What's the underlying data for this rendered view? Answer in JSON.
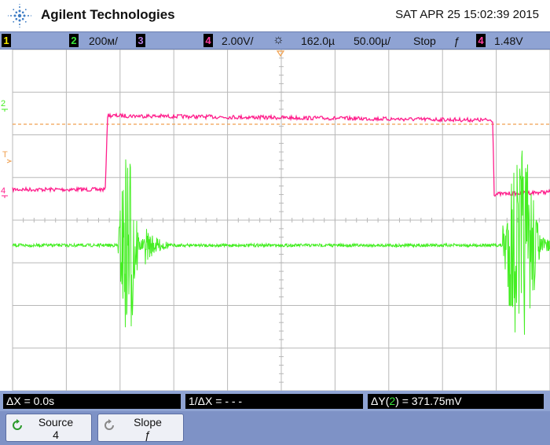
{
  "header": {
    "brand": "Agilent Technologies",
    "datetime": "SAT APR 25 15:02:39 2015"
  },
  "statusbar": {
    "ch1_label": "1",
    "ch2_label": "2",
    "ch2_scale": "200ᴍ/",
    "ch3_label": "3",
    "ch4_label": "4",
    "ch4_scale": "2.00V/",
    "acq_icon": "☼",
    "time_delay": "162.0µ",
    "timebase": "50.00µ/",
    "run_state": "Stop",
    "slope_icon": "ƒ",
    "trigger_channel": "4",
    "trigger_level": "1.48V"
  },
  "display": {
    "ch2_marker": "2",
    "trigger_marker": "T",
    "ch4_marker": "4",
    "colors": {
      "ch2": "#44ee22",
      "ch4": "#ff1f8c",
      "trigger_level": "#f0a050",
      "grid": "#b8b8b8"
    }
  },
  "measurements": {
    "dx": "ΔX = 0.0s",
    "inv_dx": "1/ΔX = - - -",
    "dy_prefix": "ΔY(",
    "dy_channel": "2",
    "dy_suffix": ") = 371.75mV"
  },
  "softkeys": [
    {
      "label": "Source",
      "value": "4",
      "icon": "refresh-icon"
    },
    {
      "label": "Slope",
      "value": "ƒ",
      "icon": "refresh-icon"
    }
  ]
}
